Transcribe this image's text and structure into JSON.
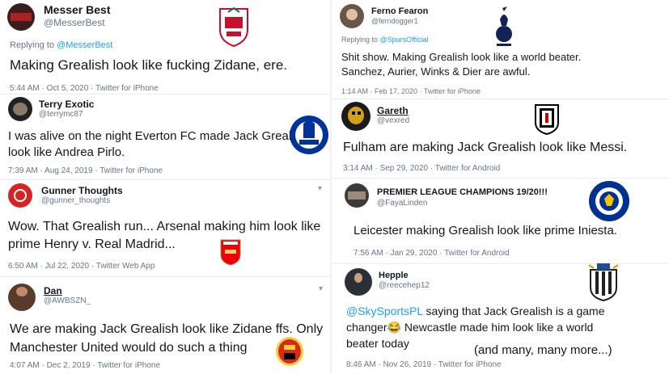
{
  "tweets": [
    {
      "name": "Messer Best",
      "handle": "@MesserBest",
      "reply_prefix": "Replying to ",
      "reply_to": "@MesserBest",
      "text": "Making Grealish look like fucking Zidane, ere.",
      "time": "5:44 AM · Oct 5, 2020 · Twitter for iPhone",
      "logo": "liverpool-crest-icon",
      "logo_color": "#c8102e"
    },
    {
      "name": "Terry Exotic",
      "handle": "@terrymc87",
      "text_lines": [
        "I was alive on the night Everton FC made Jack Grealish",
        "look like Andrea Pirlo."
      ],
      "time": "7:39 AM · Aug 24, 2019 · Twitter for iPhone",
      "logo": "everton-crest-icon",
      "logo_color": "#003399"
    },
    {
      "name": "Gunner Thoughts",
      "handle": "@gunner_thoughts",
      "text_lines": [
        "Wow. That Grealish run...  Arsenal making him look like",
        "prime Henry v. Real Madrid..."
      ],
      "time": "6:50 AM · Jul 22, 2020 · Twitter Web App",
      "logo": "arsenal-crest-icon",
      "logo_color": "#ef0107"
    },
    {
      "name": "Dan",
      "handle": "@AWBSZN_",
      "text_lines": [
        "We are making Jack Grealish look like Zidane ffs. Only",
        "Manchester United would do such a thing"
      ],
      "time": "4:07 AM · Dec 2, 2019 · Twitter for iPhone",
      "logo": "manchester-united-crest-icon",
      "logo_color": "#da291c"
    },
    {
      "name": "Ferno Fearon",
      "handle": "@ferndogger1",
      "reply_prefix": "Replying to ",
      "reply_to": "@SpursOfficial",
      "text_lines": [
        "Shit show. Making Grealish look like a world beater.",
        "Sanchez, Aurier, Winks & Dier are awful."
      ],
      "time": "1:14 AM · Feb 17, 2020 · Twitter for iPhone",
      "logo": "tottenham-crest-icon",
      "logo_color": "#132257"
    },
    {
      "name": "Gareth",
      "handle": "@vexred",
      "text": "Fulham are making Jack Grealish look like Messi.",
      "time": "3:14 AM · Sep 29, 2020 · Twitter for Android",
      "logo": "fulham-crest-icon",
      "logo_color": "#000000"
    },
    {
      "name": "PREMIER LEAGUE CHAMPIONS 19/20!!!",
      "handle": "@FayaLinden",
      "text": "Leicester making Grealish look like prime Iniesta.",
      "time": "7:56 AM · Jan 29, 2020 · Twitter for Android",
      "logo": "leicester-crest-icon",
      "logo_color": "#003090"
    },
    {
      "name": "Hepple",
      "handle": "@reecehep12",
      "mention": "@SkySportsPL",
      "text_lines": [
        " saying that Jack Grealish is a game",
        "changer😂 Newcastle made him look like a world",
        "beater today"
      ],
      "time": "8:46 AM · Nov 26, 2019 · Twitter for iPhone",
      "logo": "newcastle-crest-icon",
      "logo_color": "#241f20"
    }
  ],
  "footnote": "(and many, many more...)",
  "colors": {
    "link": "#1da1f2",
    "muted": "#657786",
    "divider": "#e6ecf0"
  }
}
